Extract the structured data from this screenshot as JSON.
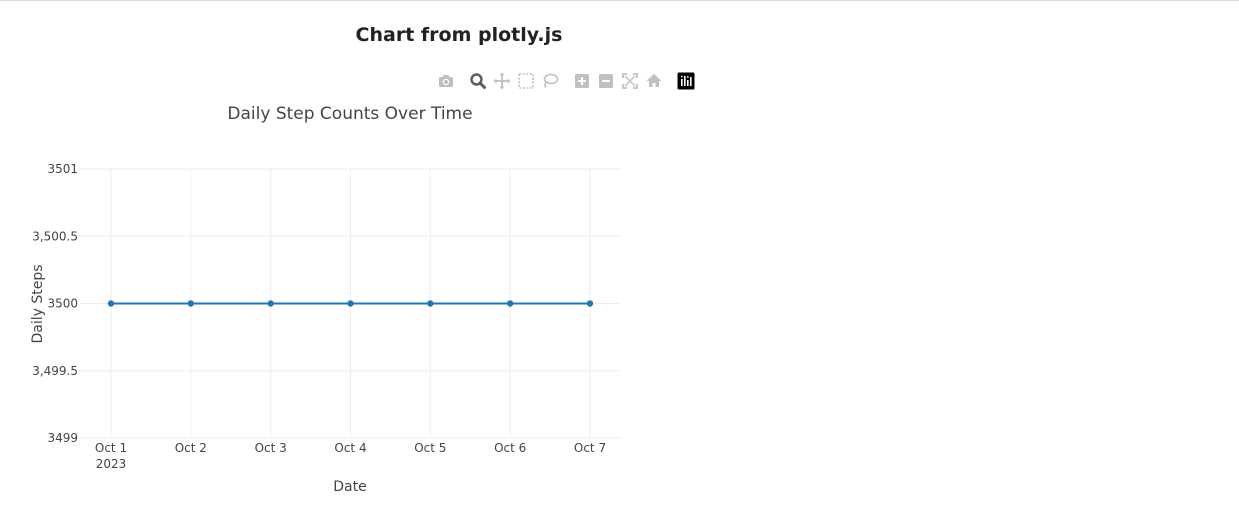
{
  "page": {
    "title": "Chart from plotly.js"
  },
  "modebar": {
    "buttons": [
      {
        "name": "camera-icon",
        "active": false
      },
      {
        "name": "zoom-icon",
        "active": true
      },
      {
        "name": "pan-icon",
        "active": false
      },
      {
        "name": "box-select-icon",
        "active": false
      },
      {
        "name": "lasso-select-icon",
        "active": false
      },
      {
        "name": "zoom-in-icon",
        "active": false
      },
      {
        "name": "zoom-out-icon",
        "active": false
      },
      {
        "name": "autoscale-icon",
        "active": false
      },
      {
        "name": "reset-axes-icon",
        "active": false
      },
      {
        "name": "plotly-logo-icon",
        "active": false
      }
    ]
  },
  "chart_data": {
    "type": "line",
    "title": "Daily Step Counts Over Time",
    "xlabel": "Date",
    "ylabel": "Daily Steps",
    "x": [
      "2023-10-01",
      "2023-10-02",
      "2023-10-03",
      "2023-10-04",
      "2023-10-05",
      "2023-10-06",
      "2023-10-07"
    ],
    "x_tick_labels": [
      "Oct 1",
      "Oct 2",
      "Oct 3",
      "Oct 4",
      "Oct 5",
      "Oct 6",
      "Oct 7"
    ],
    "x_tick_sublabel": "2023",
    "series": [
      {
        "values": [
          3500,
          3500,
          3500,
          3500,
          3500,
          3500,
          3500
        ],
        "color": "#1f77b4",
        "mode": "lines+markers"
      }
    ],
    "ylim": [
      3499,
      3501
    ],
    "y_ticks": [
      3499,
      3499.5,
      3500,
      3500.5,
      3501
    ],
    "y_tick_labels": [
      "3499",
      "3,499.5",
      "3500",
      "3,500.5",
      "3501"
    ],
    "grid": true,
    "legend": "none"
  },
  "colors": {
    "line": "#1f77b4",
    "grid": "#eeeeee",
    "text": "#444444",
    "modebar_icon": "#c0c0c0",
    "modebar_active": "#5a5a5a"
  }
}
